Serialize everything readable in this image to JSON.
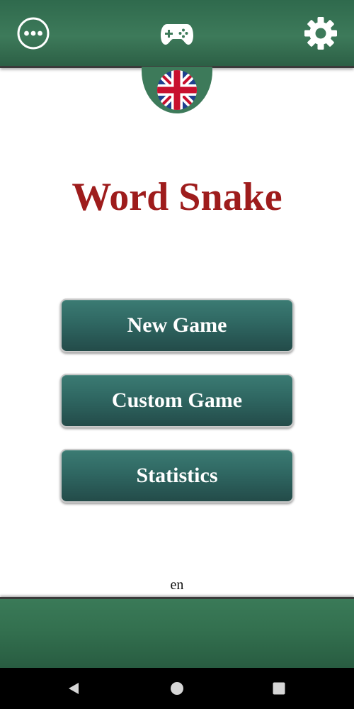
{
  "app": {
    "title": "Word Snake",
    "language_code": "en"
  },
  "top_bar": {
    "left_icon": "more-horizontal-icon",
    "center_icon": "gamepad-icon",
    "right_icon": "gear-icon"
  },
  "language_flag": {
    "icon": "uk-flag-icon"
  },
  "menu": {
    "new_game_label": "New Game",
    "custom_game_label": "Custom Game",
    "statistics_label": "Statistics"
  },
  "system_nav": {
    "back_icon": "back-triangle-icon",
    "home_icon": "home-circle-icon",
    "recents_icon": "recents-square-icon"
  },
  "colors": {
    "bar_green": "#3d7a5a",
    "button_teal": "#2f6762",
    "title_red": "#9e1c1c"
  }
}
